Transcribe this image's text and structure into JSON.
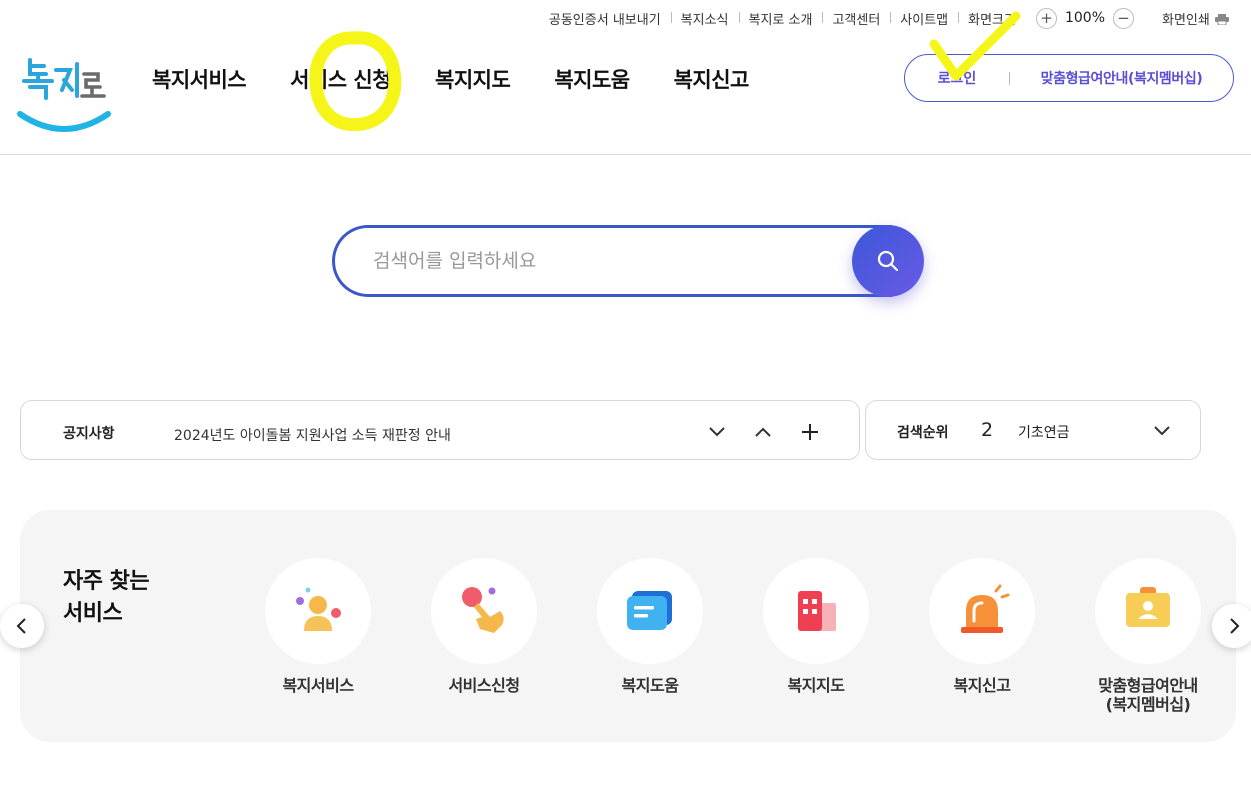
{
  "utility": {
    "links": [
      "공동인증서 내보내기",
      "복지소식",
      "복지로 소개",
      "고객센터",
      "사이트맵",
      "화면크기"
    ],
    "zoom_in": "+",
    "zoom_value": "100%",
    "zoom_out": "−",
    "print_label": "화면인쇄"
  },
  "logo": {
    "text": "복지로"
  },
  "gnb": [
    "복지서비스",
    "서비스 신청",
    "복지지도",
    "복지도움",
    "복지신고"
  ],
  "member": {
    "login": "로그인",
    "custom": "맞춤형급여안내(복지멤버십)"
  },
  "search": {
    "placeholder": "검색어를 입력하세요"
  },
  "notice": {
    "title": "공지사항",
    "text": "2024년도 아이돌봄 지원사업 소득 재판정 안내"
  },
  "rank": {
    "title": "검색순위",
    "number": "2",
    "term": "기초연금"
  },
  "frequent": {
    "title": "자주 찾는\n서비스",
    "items": [
      {
        "label": "복지서비스",
        "icon": "person-icon"
      },
      {
        "label": "서비스신청",
        "icon": "hand-tap-icon"
      },
      {
        "label": "복지도움",
        "icon": "message-icon"
      },
      {
        "label": "복지지도",
        "icon": "building-icon"
      },
      {
        "label": "복지신고",
        "icon": "siren-icon"
      },
      {
        "label": "맞춤형급여안내\n(복지멤버십)",
        "icon": "id-card-icon"
      }
    ]
  },
  "colors": {
    "accent": "#3b57c9",
    "member_text": "#5b4fd6",
    "highlight": "#f5f51a",
    "panel_bg": "#f5f5f5"
  }
}
